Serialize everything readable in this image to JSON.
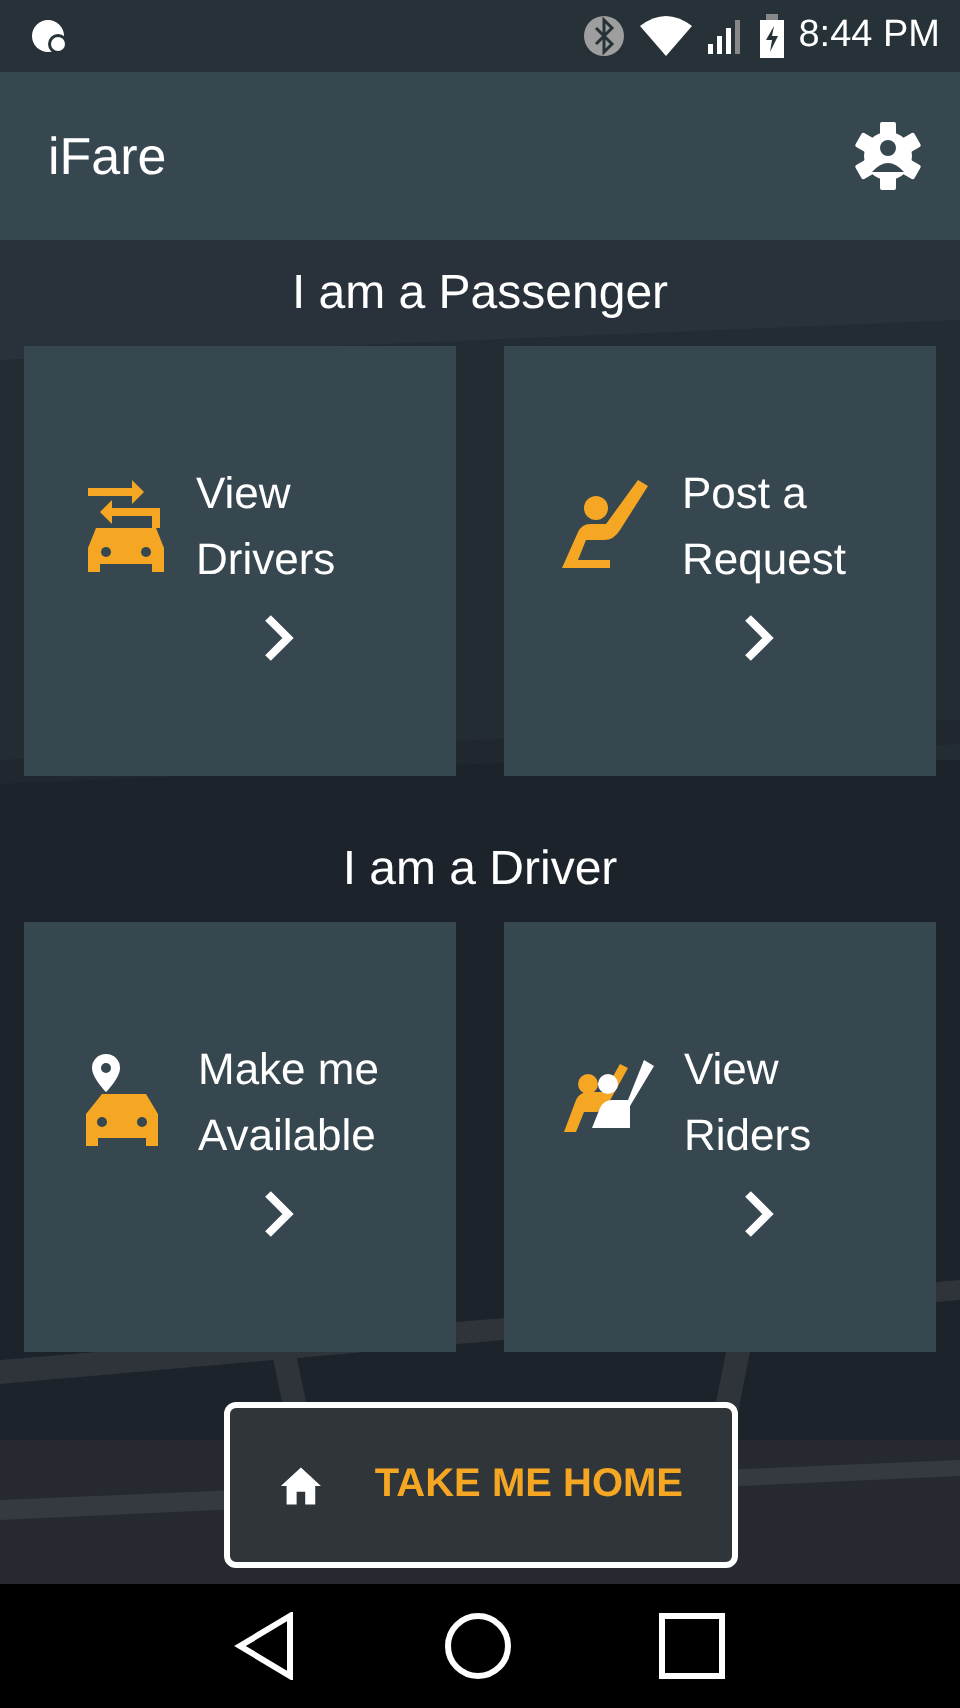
{
  "status_bar": {
    "time": "8:44 PM"
  },
  "app_bar": {
    "title": "iFare"
  },
  "sections": [
    {
      "heading": "I am a Passenger",
      "cards": [
        {
          "label": "View Drivers"
        },
        {
          "label": "Post a Request"
        }
      ]
    },
    {
      "heading": "I am a Driver",
      "cards": [
        {
          "label": "Make me Available"
        },
        {
          "label": "View Riders"
        }
      ]
    }
  ],
  "home_button": {
    "label": "TAKE ME HOME"
  }
}
